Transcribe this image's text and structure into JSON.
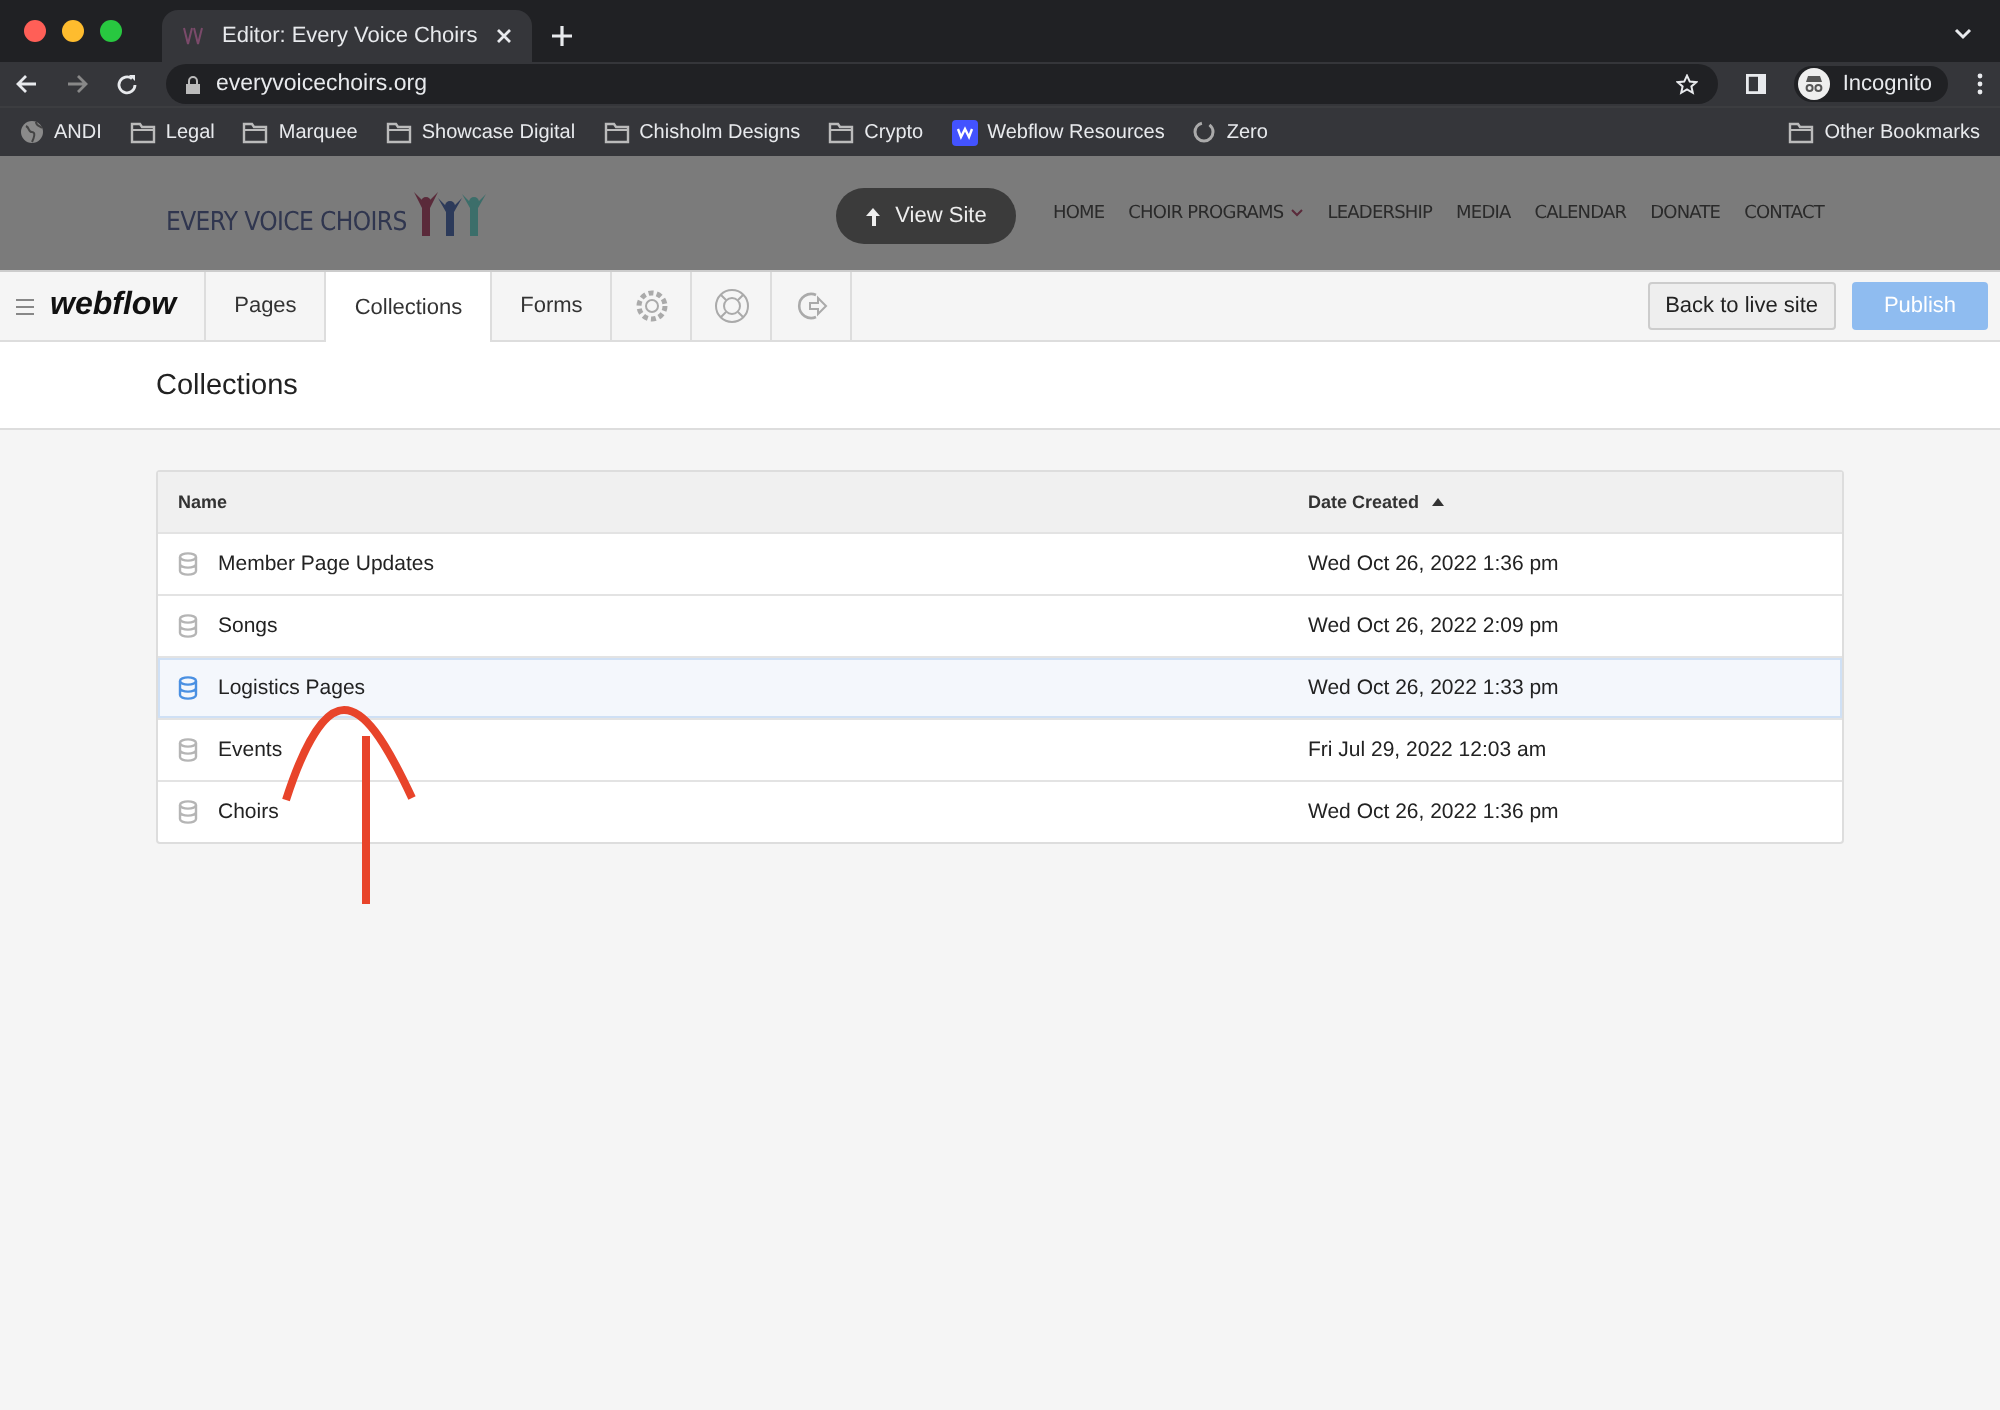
{
  "browser": {
    "tab_title": "Editor: Every Voice Choirs",
    "url": "everyvoicechoirs.org",
    "profile": "Incognito",
    "bookmarks": [
      {
        "label": "ANDI",
        "kind": "globe"
      },
      {
        "label": "Legal",
        "kind": "folder"
      },
      {
        "label": "Marquee",
        "kind": "folder"
      },
      {
        "label": "Showcase Digital",
        "kind": "folder"
      },
      {
        "label": "Chisholm Designs",
        "kind": "folder"
      },
      {
        "label": "Crypto",
        "kind": "folder"
      },
      {
        "label": "Webflow Resources",
        "kind": "w"
      },
      {
        "label": "Zero",
        "kind": "ring"
      }
    ],
    "other_bookmarks": "Other Bookmarks"
  },
  "site": {
    "logo": "EVERY VOICE CHOIRS",
    "view_site": "View Site",
    "nav": [
      {
        "label": "HOME",
        "dropdown": false
      },
      {
        "label": "CHOIR PROGRAMS",
        "dropdown": true
      },
      {
        "label": "LEADERSHIP",
        "dropdown": false
      },
      {
        "label": "MEDIA",
        "dropdown": false
      },
      {
        "label": "CALENDAR",
        "dropdown": false
      },
      {
        "label": "DONATE",
        "dropdown": false
      },
      {
        "label": "CONTACT",
        "dropdown": false
      }
    ]
  },
  "editor": {
    "brand": "webflow",
    "tabs": [
      {
        "label": "Pages",
        "selected": false
      },
      {
        "label": "Collections",
        "selected": true
      },
      {
        "label": "Forms",
        "selected": false
      }
    ],
    "icon_tabs": [
      {
        "kind": "gear"
      },
      {
        "kind": "help"
      },
      {
        "kind": "exit"
      }
    ],
    "back_button": "Back to live site",
    "publish_button": "Publish",
    "publish_disabled": true
  },
  "page_title": "Collections",
  "table": {
    "columns": [
      {
        "label": "Name",
        "sorted": false
      },
      {
        "label": "Date Created",
        "sorted": true
      }
    ],
    "rows": [
      {
        "name": "Member Page Updates",
        "date": "Wed Oct 26, 2022 1:36 pm",
        "selected": false
      },
      {
        "name": "Songs",
        "date": "Wed Oct 26, 2022 2:09 pm",
        "selected": false
      },
      {
        "name": "Logistics Pages",
        "date": "Wed Oct 26, 2022 1:33 pm",
        "selected": true
      },
      {
        "name": "Events",
        "date": "Fri Jul 29, 2022 12:03 am",
        "selected": false
      },
      {
        "name": "Choirs",
        "date": "Wed Oct 26, 2022 1:36 pm",
        "selected": false
      }
    ]
  }
}
